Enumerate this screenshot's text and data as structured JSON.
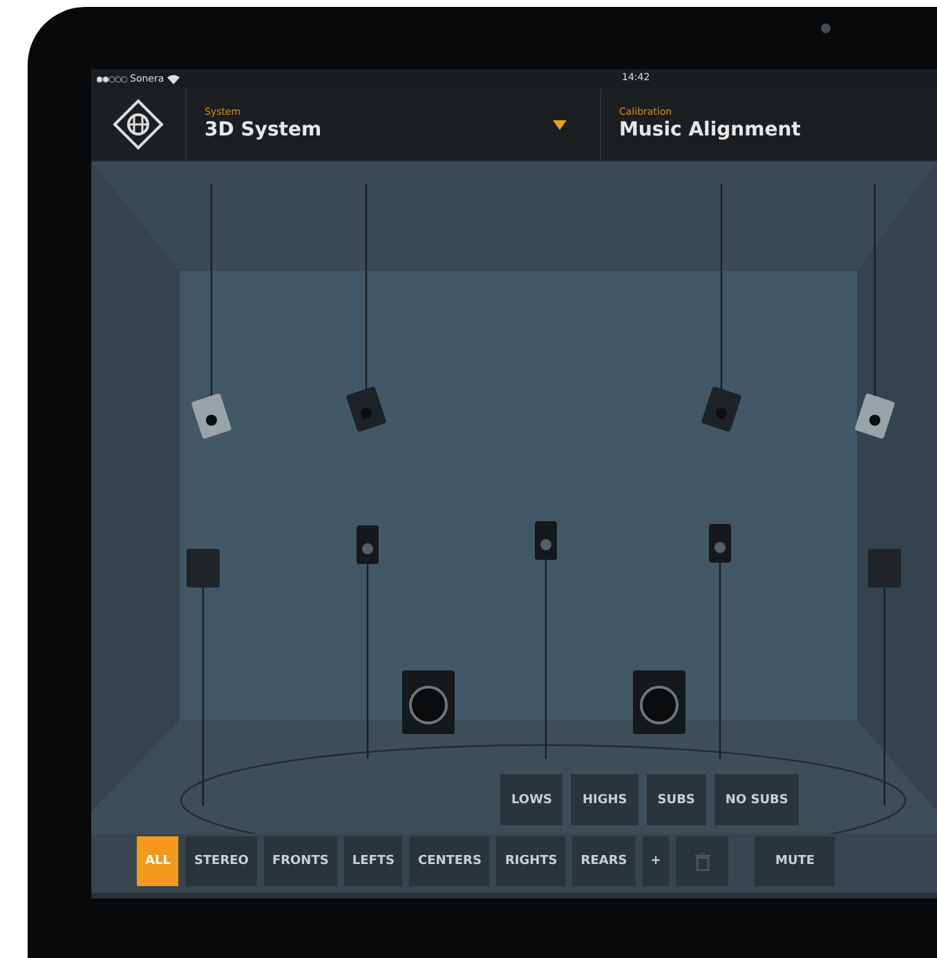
{
  "status_bar": {
    "carrier": "Sonera",
    "time": "14:42"
  },
  "header": {
    "system": {
      "label": "System",
      "value": "3D System"
    },
    "calibration": {
      "label": "Calibration",
      "value": "Music Alignment"
    }
  },
  "band_filters": [
    {
      "label": "LOWS",
      "selected": false
    },
    {
      "label": "HIGHS",
      "selected": false
    },
    {
      "label": "SUBS",
      "selected": false
    },
    {
      "label": "NO SUBS",
      "selected": false
    }
  ],
  "group_filters": [
    {
      "kind": "text",
      "label": "ALL",
      "selected": true
    },
    {
      "kind": "text",
      "label": "STEREO",
      "selected": false
    },
    {
      "kind": "text",
      "label": "FRONTS",
      "selected": false
    },
    {
      "kind": "text",
      "label": "LEFTS",
      "selected": false
    },
    {
      "kind": "text",
      "label": "CENTERS",
      "selected": false
    },
    {
      "kind": "text",
      "label": "RIGHTS",
      "selected": false
    },
    {
      "kind": "text",
      "label": "REARS",
      "selected": false
    },
    {
      "kind": "text",
      "label": "+",
      "selected": false
    },
    {
      "kind": "trash",
      "selected": false
    }
  ],
  "mute": {
    "label": "MUTE"
  }
}
